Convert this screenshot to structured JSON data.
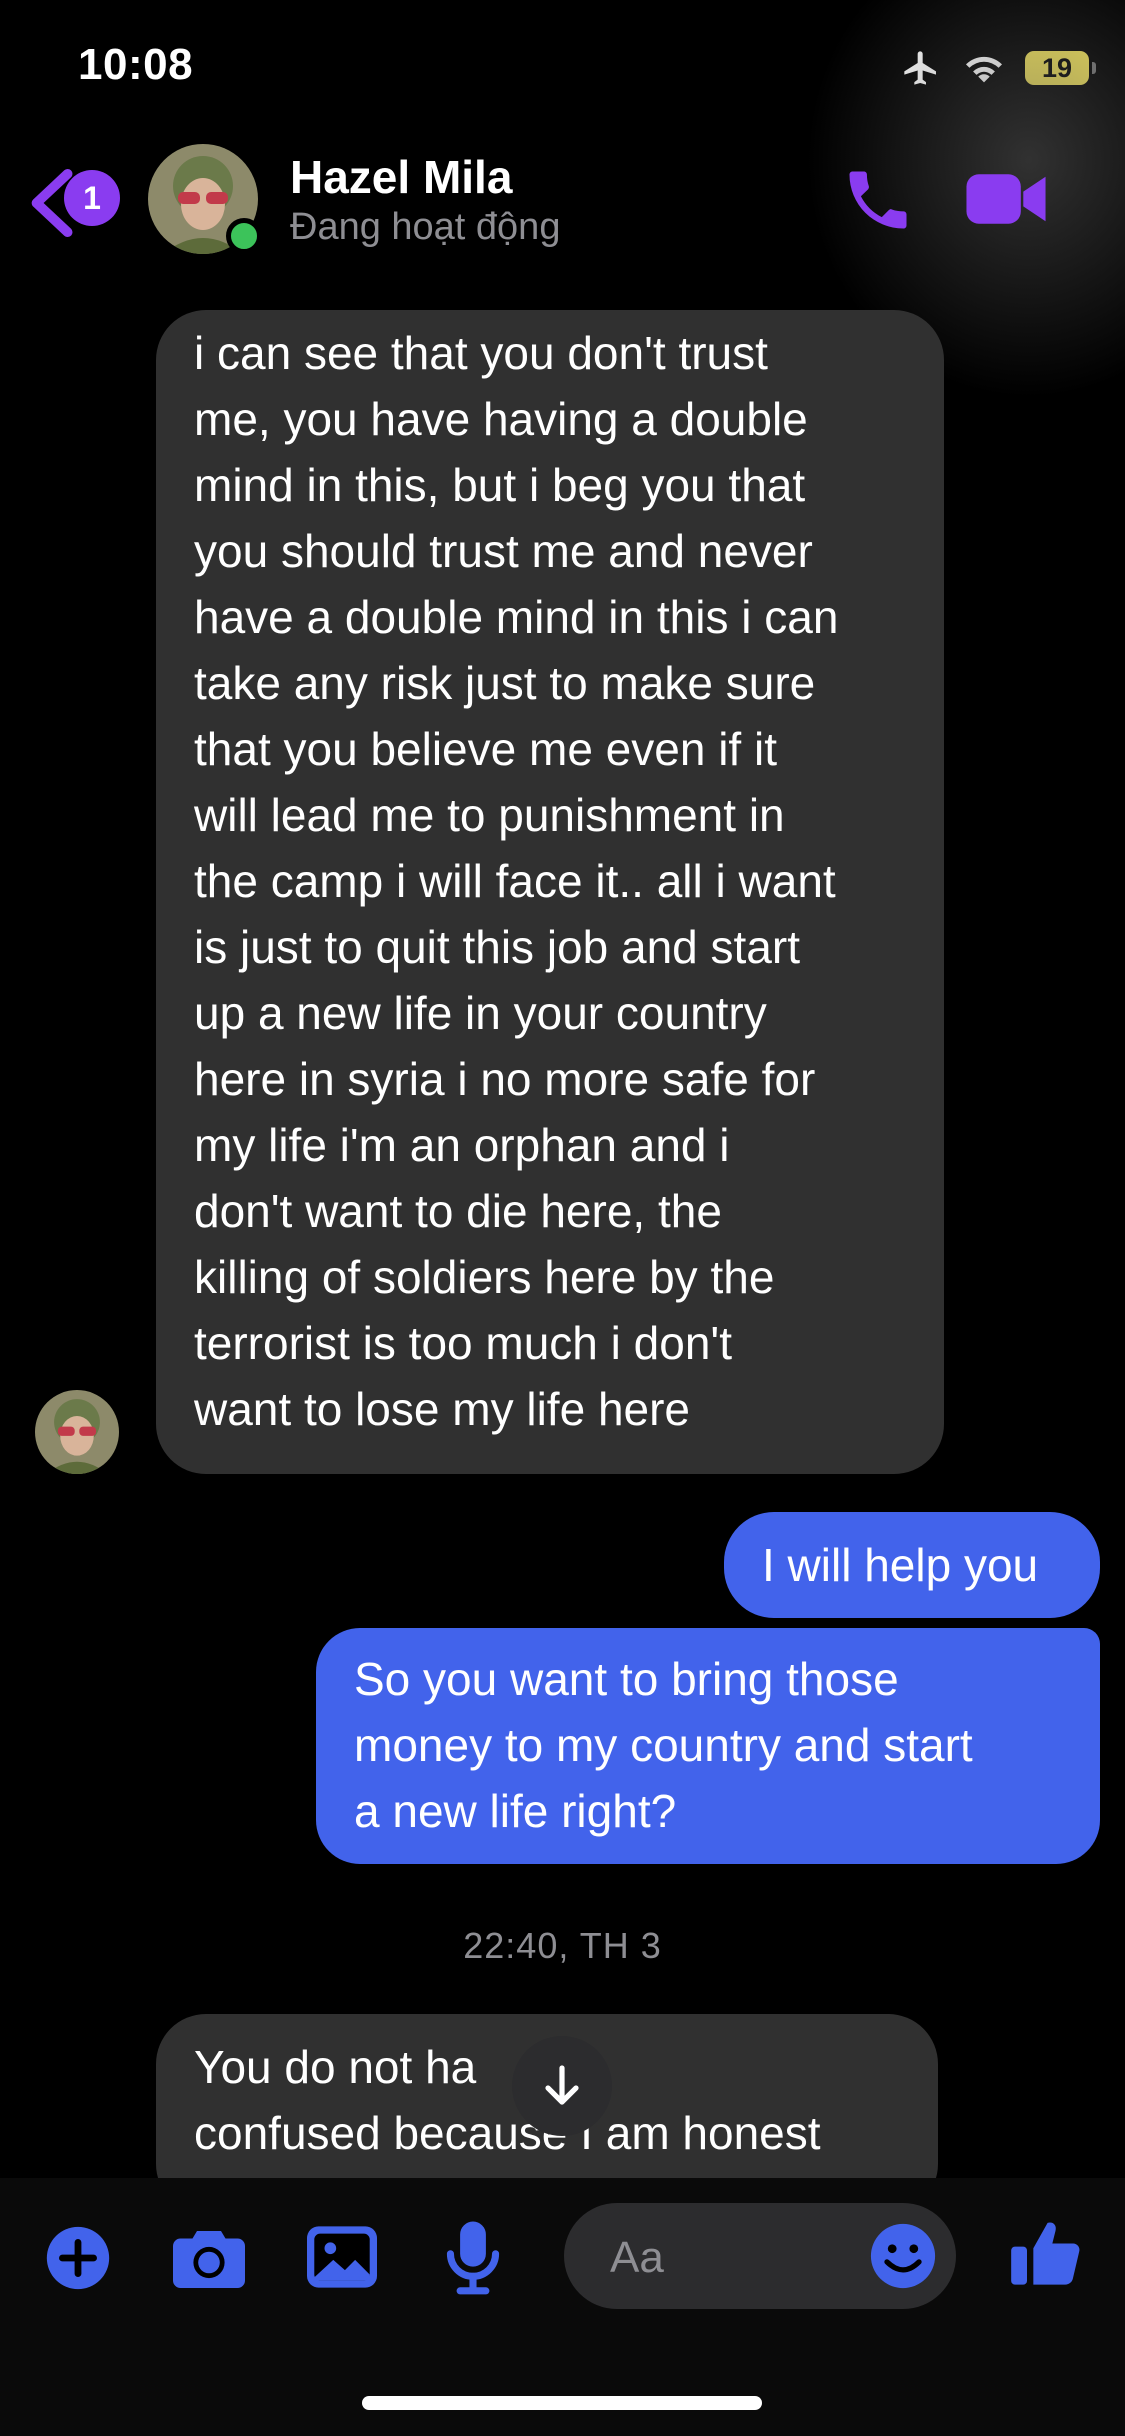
{
  "status_bar": {
    "time": "10:08",
    "battery_level": "19",
    "icons": [
      "airplane-icon",
      "wifi-icon",
      "battery-icon"
    ]
  },
  "header": {
    "unread_count": "1",
    "contact_name": "Hazel Mila",
    "contact_status": "Đang hoạt động",
    "accent_color": "#8a3cf0"
  },
  "messages": [
    {
      "direction": "incoming",
      "lines": [
        "i can see that you don't trust",
        "me, you have having a double",
        "mind in this, but i beg you that",
        "you should trust me and never",
        "have a double mind in this i can",
        "take any risk just to make sure",
        "that you believe me even if it",
        "will lead me to punishment in",
        "the camp i will face it.. all i want",
        "is just to quit this job and start",
        "up a new life in your country",
        "here in syria i no more safe for",
        "my life i'm an orphan and i",
        "don't want to die here, the",
        "killing of soldiers here by the",
        "terrorist is too much i don't",
        "want to lose my life here"
      ]
    },
    {
      "direction": "outgoing",
      "lines": [
        "I will help you"
      ]
    },
    {
      "direction": "outgoing",
      "lines": [
        "So you want to bring those",
        "money to my country and start",
        "a new life right?"
      ]
    },
    {
      "direction": "incoming",
      "lines": [
        "You do not ha     be",
        "confused because I am honest"
      ]
    }
  ],
  "timestamp": "22:40, TH 3",
  "composer": {
    "placeholder": "Aa",
    "outgoing_color": "#4263eb",
    "icons": [
      "plus-icon",
      "camera-icon",
      "image-icon",
      "microphone-icon",
      "emoji-icon",
      "thumbs-up-icon"
    ]
  }
}
